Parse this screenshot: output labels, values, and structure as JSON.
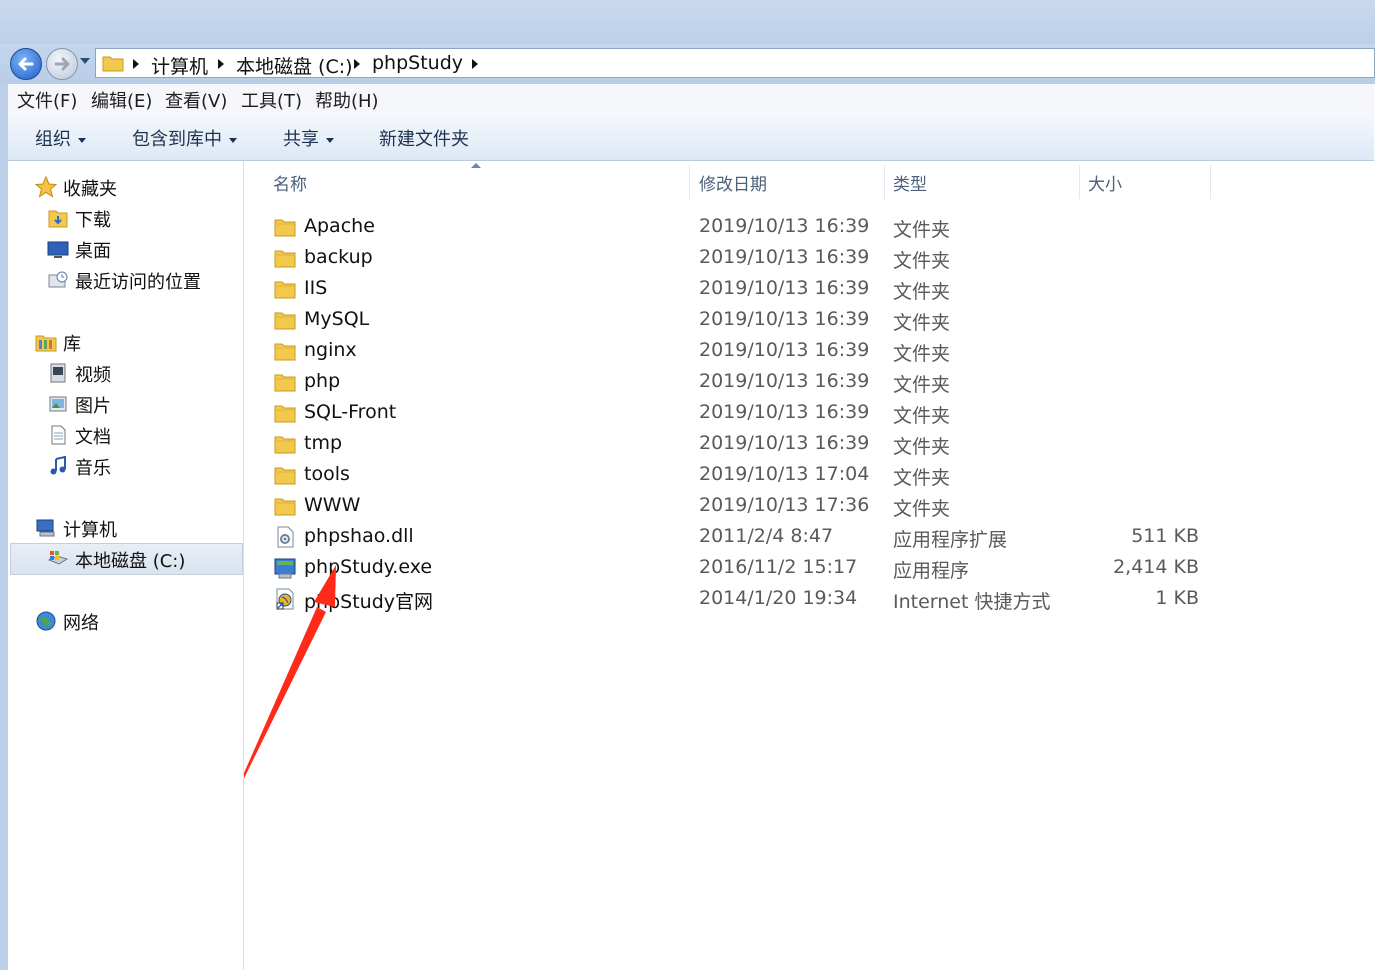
{
  "address": {
    "crumbs": [
      "计算机",
      "本地磁盘 (C:)",
      "phpStudy"
    ]
  },
  "menu": [
    "文件(F)",
    "编辑(E)",
    "查看(V)",
    "工具(T)",
    "帮助(H)"
  ],
  "toolbar": {
    "organize": "组织",
    "include_library": "包含到库中",
    "share": "共享",
    "new_folder": "新建文件夹"
  },
  "sidebar": {
    "favorites": "收藏夹",
    "downloads": "下载",
    "desktop": "桌面",
    "recent": "最近访问的位置",
    "libraries": "库",
    "videos": "视频",
    "pictures": "图片",
    "documents": "文档",
    "music": "音乐",
    "computer": "计算机",
    "local_disk": "本地磁盘 (C:)",
    "network": "网络"
  },
  "columns": {
    "name": "名称",
    "date": "修改日期",
    "type": "类型",
    "size": "大小"
  },
  "files": [
    {
      "name": "Apache",
      "date": "2019/10/13 16:39",
      "type": "文件夹",
      "size": "",
      "icon": "folder-icon"
    },
    {
      "name": "backup",
      "date": "2019/10/13 16:39",
      "type": "文件夹",
      "size": "",
      "icon": "folder-icon"
    },
    {
      "name": "IIS",
      "date": "2019/10/13 16:39",
      "type": "文件夹",
      "size": "",
      "icon": "folder-icon"
    },
    {
      "name": "MySQL",
      "date": "2019/10/13 16:39",
      "type": "文件夹",
      "size": "",
      "icon": "folder-icon"
    },
    {
      "name": "nginx",
      "date": "2019/10/13 16:39",
      "type": "文件夹",
      "size": "",
      "icon": "folder-icon"
    },
    {
      "name": "php",
      "date": "2019/10/13 16:39",
      "type": "文件夹",
      "size": "",
      "icon": "folder-icon"
    },
    {
      "name": "SQL-Front",
      "date": "2019/10/13 16:39",
      "type": "文件夹",
      "size": "",
      "icon": "folder-icon"
    },
    {
      "name": "tmp",
      "date": "2019/10/13 16:39",
      "type": "文件夹",
      "size": "",
      "icon": "folder-icon"
    },
    {
      "name": "tools",
      "date": "2019/10/13 17:04",
      "type": "文件夹",
      "size": "",
      "icon": "folder-icon"
    },
    {
      "name": "WWW",
      "date": "2019/10/13 17:36",
      "type": "文件夹",
      "size": "",
      "icon": "folder-icon"
    },
    {
      "name": "phpshao.dll",
      "date": "2011/2/4 8:47",
      "type": "应用程序扩展",
      "size": "511 KB",
      "icon": "dll-file-icon"
    },
    {
      "name": "phpStudy.exe",
      "date": "2016/11/2 15:17",
      "type": "应用程序",
      "size": "2,414 KB",
      "icon": "application-icon"
    },
    {
      "name": "phpStudy官网",
      "date": "2014/1/20 19:34",
      "type": "Internet 快捷方式",
      "size": "1 KB",
      "icon": "internet-shortcut-icon"
    }
  ],
  "annotation": {
    "color": "#ff2a1a"
  },
  "colors": {
    "folder": "#f2c94c",
    "selection": "#dae3ee",
    "chrome": "#bcd0ea"
  }
}
